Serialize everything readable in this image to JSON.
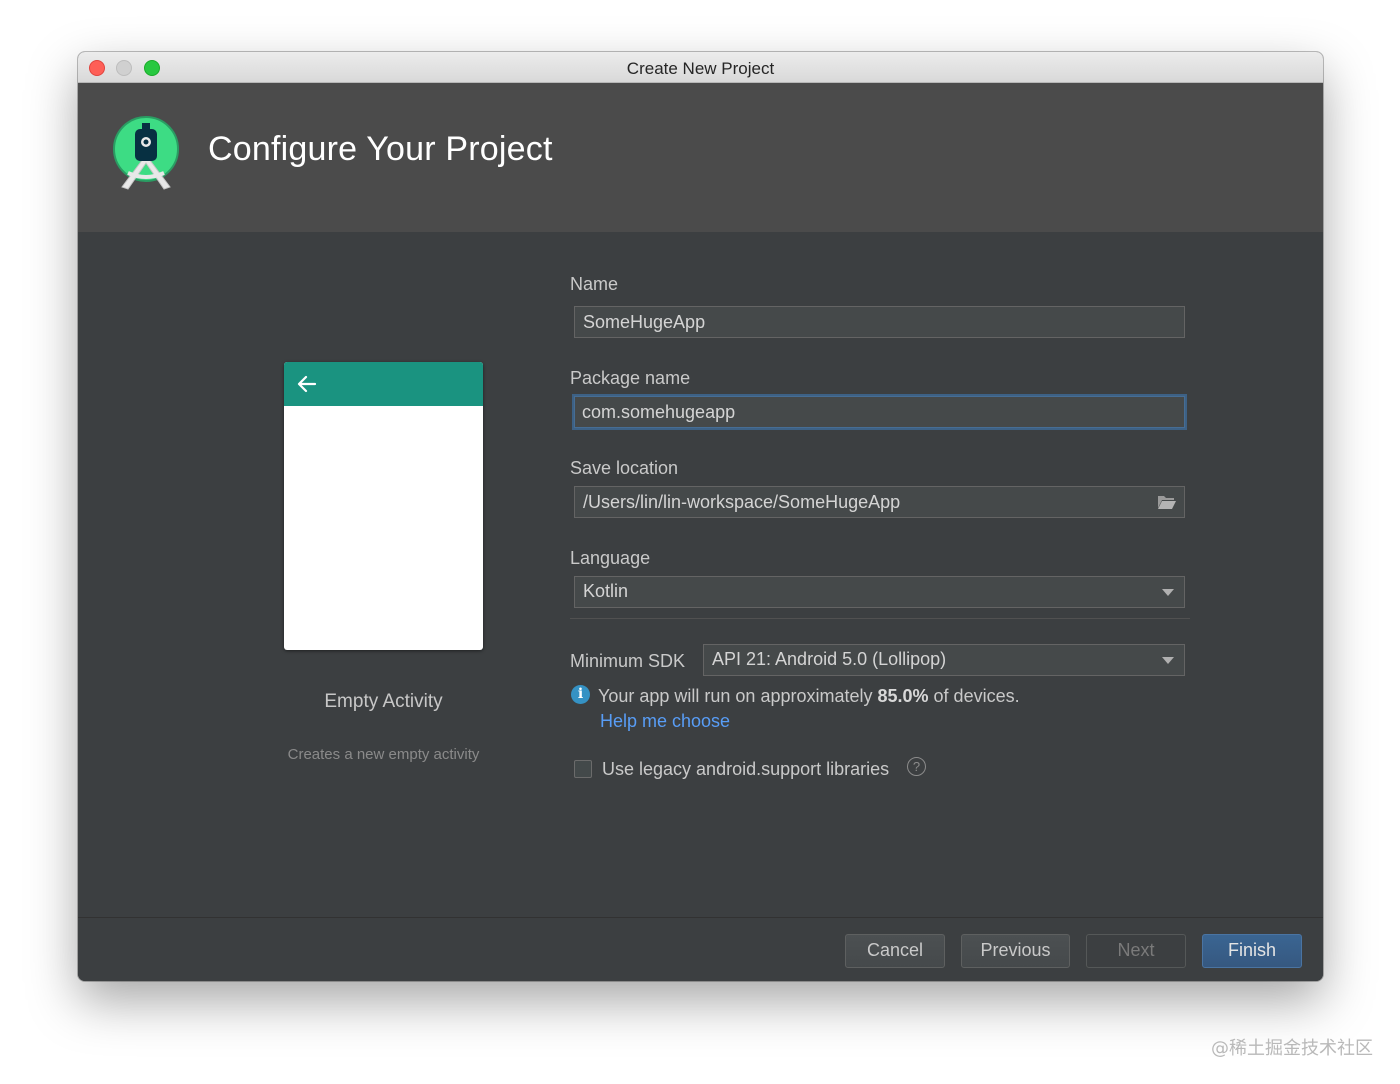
{
  "window": {
    "title": "Create New Project"
  },
  "header": {
    "title": "Configure Your Project",
    "logo_icon": "android-studio-logo-icon"
  },
  "template": {
    "name": "Empty Activity",
    "description": "Creates a new empty activity",
    "toolbar_color": "#1a9380",
    "back_icon": "arrow-left-icon"
  },
  "form": {
    "name": {
      "label": "Name",
      "value": "SomeHugeApp"
    },
    "package_name": {
      "label": "Package name",
      "value": "com.somehugeapp"
    },
    "save_location": {
      "label": "Save location",
      "value": "/Users/lin/lin-workspace/SomeHugeApp",
      "icon": "folder-icon"
    },
    "language": {
      "label": "Language",
      "selected": "Kotlin"
    },
    "minimum_sdk": {
      "label": "Minimum SDK",
      "selected": "API 21: Android 5.0 (Lollipop)"
    },
    "info": {
      "prefix": "Your app will run on approximately ",
      "percentage": "85.0%",
      "suffix": " of devices.",
      "help_link": "Help me choose"
    },
    "legacy_support": {
      "label": "Use legacy android.support libraries",
      "checked": false
    }
  },
  "footer": {
    "cancel_label": "Cancel",
    "previous_label": "Previous",
    "next_label": "Next",
    "finish_label": "Finish"
  },
  "watermark": "@稀土掘金技术社区",
  "colors": {
    "accent": "#365880",
    "link": "#589df6",
    "info": "#3592c4",
    "background": "#3c3f41",
    "header": "#4b4b4b"
  }
}
